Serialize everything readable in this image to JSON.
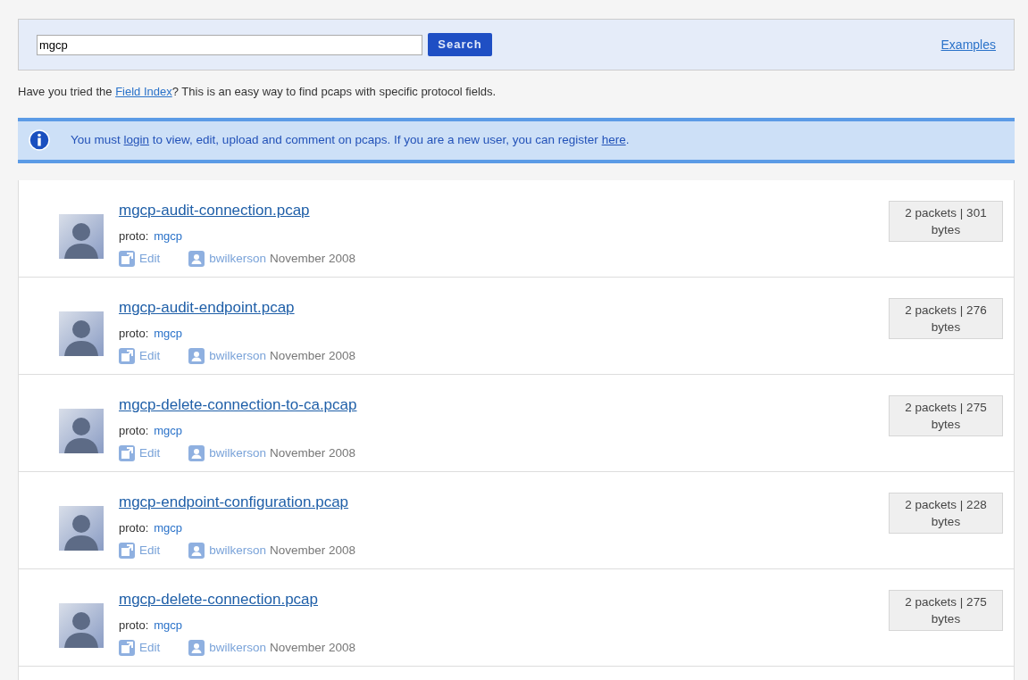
{
  "search": {
    "value": "mgcp",
    "button": "Search",
    "examples_link": "Examples"
  },
  "hint": {
    "before": "Have you tried the ",
    "link": "Field Index",
    "after": "? This is an easy way to find pcaps with specific protocol fields."
  },
  "notice": {
    "before": "You must ",
    "link1": "login",
    "middle": " to view, edit, upload and comment on pcaps. If you are a new user, you can register ",
    "link2": "here",
    "after": "."
  },
  "results": [
    {
      "title": "mgcp-audit-connection.pcap",
      "proto_label": "proto:",
      "proto": "mgcp",
      "edit": "Edit",
      "user": "bwilkerson",
      "date": "November 2008",
      "size": "2 packets | 301 bytes"
    },
    {
      "title": "mgcp-audit-endpoint.pcap",
      "proto_label": "proto:",
      "proto": "mgcp",
      "edit": "Edit",
      "user": "bwilkerson",
      "date": "November 2008",
      "size": "2 packets | 276 bytes"
    },
    {
      "title": "mgcp-delete-connection-to-ca.pcap",
      "proto_label": "proto:",
      "proto": "mgcp",
      "edit": "Edit",
      "user": "bwilkerson",
      "date": "November 2008",
      "size": "2 packets | 275 bytes"
    },
    {
      "title": "mgcp-endpoint-configuration.pcap",
      "proto_label": "proto:",
      "proto": "mgcp",
      "edit": "Edit",
      "user": "bwilkerson",
      "date": "November 2008",
      "size": "2 packets | 228 bytes"
    },
    {
      "title": "mgcp-delete-connection.pcap",
      "proto_label": "proto:",
      "proto": "mgcp",
      "edit": "Edit",
      "user": "bwilkerson",
      "date": "November 2008",
      "size": "2 packets | 275 bytes"
    }
  ]
}
